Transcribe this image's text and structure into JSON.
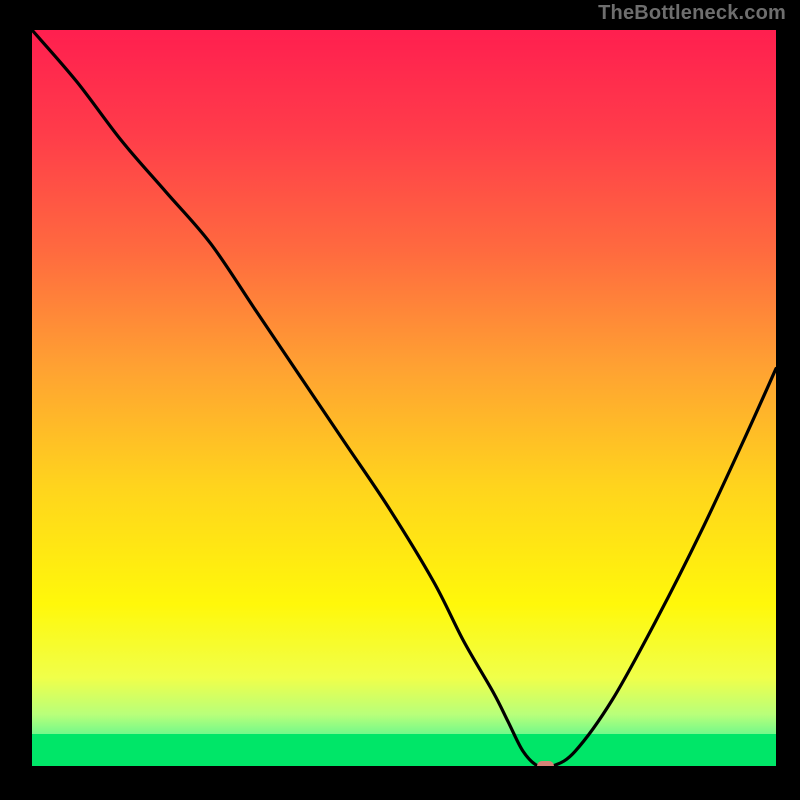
{
  "watermark": "TheBottleneck.com",
  "chart_data": {
    "type": "line",
    "title": "",
    "xlabel": "",
    "ylabel": "",
    "xlim": [
      0,
      100
    ],
    "ylim": [
      0,
      100
    ],
    "grid": false,
    "legend": false,
    "background": {
      "type": "vertical-gradient",
      "stops": [
        {
          "pos": 0.0,
          "color": "#ff1f4f"
        },
        {
          "pos": 0.14,
          "color": "#ff3c4a"
        },
        {
          "pos": 0.3,
          "color": "#ff6a3f"
        },
        {
          "pos": 0.46,
          "color": "#ffa232"
        },
        {
          "pos": 0.62,
          "color": "#ffd41d"
        },
        {
          "pos": 0.78,
          "color": "#fff80a"
        },
        {
          "pos": 0.88,
          "color": "#f0ff4a"
        },
        {
          "pos": 0.93,
          "color": "#b8ff7a"
        },
        {
          "pos": 0.965,
          "color": "#5ef78f"
        },
        {
          "pos": 1.0,
          "color": "#00e668"
        }
      ]
    },
    "series": [
      {
        "name": "bottleneck-curve",
        "color": "#000000",
        "x": [
          0,
          6,
          12,
          18,
          24,
          30,
          36,
          42,
          48,
          54,
          58,
          62,
          64,
          66,
          68,
          70,
          73,
          78,
          84,
          90,
          96,
          100
        ],
        "y": [
          100,
          93,
          85,
          78,
          71,
          62,
          53,
          44,
          35,
          25,
          17,
          10,
          6,
          2,
          0,
          0,
          2,
          9,
          20,
          32,
          45,
          54
        ]
      }
    ],
    "marker": {
      "name": "optimal-point",
      "x": 69,
      "y": 0,
      "color": "#d58277",
      "shape": "rounded-rect",
      "width_pct": 2.2,
      "height_pct": 1.4
    }
  },
  "colors": {
    "page_bg": "#000000",
    "curve": "#000000",
    "marker": "#d58277",
    "watermark": "#6e6e6e"
  }
}
